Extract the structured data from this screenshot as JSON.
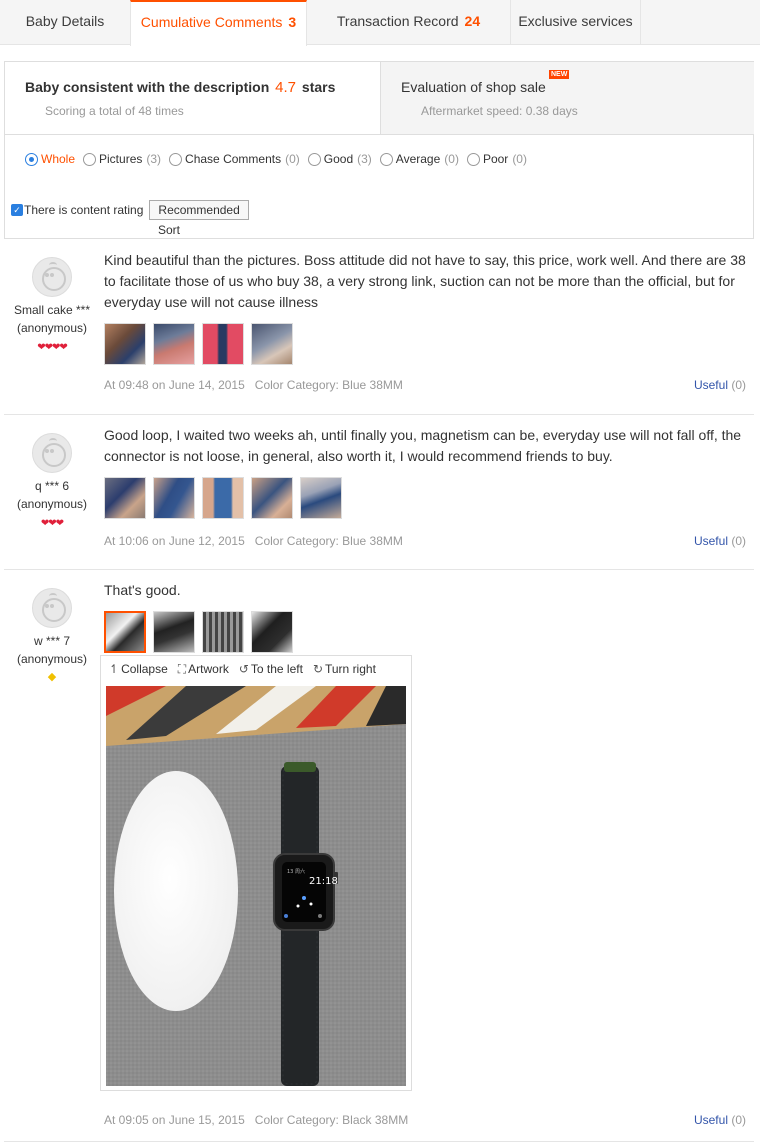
{
  "tabs": [
    {
      "label": "Baby Details",
      "count": ""
    },
    {
      "label": "Cumulative Comments",
      "count": "3"
    },
    {
      "label": "Transaction Record",
      "count": "24"
    },
    {
      "label": "Exclusive services",
      "count": ""
    }
  ],
  "summary": {
    "desc_prefix": "Baby consistent with the description",
    "desc_score": "4.7",
    "desc_suffix": "stars",
    "desc_sub": "Scoring a total of 48 times",
    "shop_title": "Evaluation of shop sale",
    "shop_badge": "NEW",
    "shop_sub": "Aftermarket speed: 0.38 days"
  },
  "filters": {
    "options": [
      {
        "label": "Whole",
        "count": ""
      },
      {
        "label": "Pictures",
        "count": "(3)"
      },
      {
        "label": "Chase Comments",
        "count": "(0)"
      },
      {
        "label": "Good",
        "count": "(3)"
      },
      {
        "label": "Average",
        "count": "(0)"
      },
      {
        "label": "Poor",
        "count": "(0)"
      }
    ],
    "selected": "Whole",
    "content_rating_label": "There is content rating",
    "sort_button": "Recommended",
    "sort_label": "Sort"
  },
  "reviews": [
    {
      "user": "Small cake ***",
      "anon": "(anonymous)",
      "level": "❤❤❤❤",
      "text": "Kind beautiful than the pictures. Boss attitude did not have to say, this price, work well. And there are 38 to facilitate those of us who buy 38, a very strong link, suction can not be more than the official, but for everyday use will not cause illness",
      "date": "At 09:48 on June 14, 2015",
      "category": "Color Category: Blue 38MM",
      "useful_label": "Useful",
      "useful_count": "(0)"
    },
    {
      "user": "q *** 6",
      "anon": "(anonymous)",
      "level": "❤❤❤",
      "text": "Good loop, I waited two weeks ah, until finally you, magnetism can be, everyday use will not fall off, the connector is not loose, in general, also worth it, I would recommend friends to buy.",
      "date": "At 10:06 on June 12, 2015",
      "category": "Color Category: Blue 38MM",
      "useful_label": "Useful",
      "useful_count": "(0)"
    },
    {
      "user": "w *** 7",
      "anon": "(anonymous)",
      "level": "◆",
      "text": "That's good.",
      "date": "At 09:05 on June 15, 2015",
      "category": "Color Category: Black 38MM",
      "useful_label": "Useful",
      "useful_count": "(0)"
    }
  ],
  "viewer": {
    "collapse": "Collapse",
    "artwork": "Artwork",
    "left": "To the left",
    "right": "Turn right",
    "watch_time": "21:18",
    "watch_date": "13 周六"
  },
  "colors": {
    "accent": "#ff5000",
    "link": "#3355aa",
    "muted": "#999999"
  }
}
